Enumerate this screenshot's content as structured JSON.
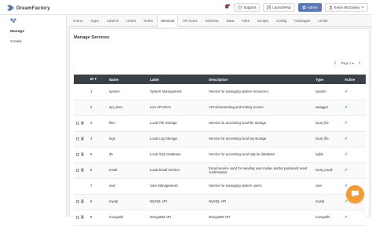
{
  "app": {
    "brand": "DreamFactory"
  },
  "topbar": {
    "support_label": "Support",
    "launchpad_label": "LaunchPad",
    "admin_label": "Admin",
    "user_label": "Kevin McGahey"
  },
  "sidebar": {
    "items": [
      {
        "label": "Manage",
        "active": true
      },
      {
        "label": "Create",
        "active": false
      }
    ]
  },
  "nav": {
    "tabs": [
      {
        "label": "Home",
        "active": false
      },
      {
        "label": "Apps",
        "active": false
      },
      {
        "label": "Admins",
        "active": false
      },
      {
        "label": "Users",
        "active": false
      },
      {
        "label": "Roles",
        "active": false
      },
      {
        "label": "Services",
        "active": true
      },
      {
        "label": "API Docs",
        "active": false
      },
      {
        "label": "Schema",
        "active": false
      },
      {
        "label": "Data",
        "active": false
      },
      {
        "label": "Files",
        "active": false
      },
      {
        "label": "Scripts",
        "active": false
      },
      {
        "label": "Config",
        "active": false
      },
      {
        "label": "Packages",
        "active": false
      },
      {
        "label": "Limits",
        "active": false
      }
    ]
  },
  "panel": {
    "title": "Manage Services",
    "pager": "Page 1"
  },
  "table": {
    "headers": {
      "id": "ID",
      "name": "Name",
      "label": "Label",
      "description": "Description",
      "type": "Type",
      "active": "Active"
    },
    "rows": [
      {
        "selectable": false,
        "id": "1",
        "name": "system",
        "label": "System Management",
        "description": "Service for managing system resources.",
        "type": "system",
        "active": "✓"
      },
      {
        "selectable": false,
        "id": "2",
        "name": "api_docs",
        "label": "Live API Docs",
        "description": "API documenting and testing service.",
        "type": "swagger",
        "active": "✓"
      },
      {
        "selectable": true,
        "id": "3",
        "name": "files",
        "label": "Local File Storage",
        "description": "Service for accessing local file storage.",
        "type": "local_file",
        "active": "✓"
      },
      {
        "selectable": true,
        "id": "4",
        "name": "logs",
        "label": "Local Log Storage",
        "description": "Service for accessing local log storage.",
        "type": "local_file",
        "active": "✓"
      },
      {
        "selectable": true,
        "id": "5",
        "name": "db",
        "label": "Local SQL Database",
        "description": "Service for accessing local SQLite database.",
        "type": "sqlite",
        "active": "✓"
      },
      {
        "selectable": true,
        "id": "6",
        "name": "email",
        "label": "Local Email Service",
        "description": "Email service used for sending user invites and/or password reset confirmation.",
        "type": "local_email",
        "active": "✓"
      },
      {
        "selectable": false,
        "id": "7",
        "name": "user",
        "label": "User Management",
        "description": "Service for managing system users.",
        "type": "user",
        "active": "✓"
      },
      {
        "selectable": true,
        "id": "8",
        "name": "mysql",
        "label": "MySQL API",
        "description": "MySQL API",
        "type": "mysql",
        "active": "✓"
      },
      {
        "selectable": true,
        "id": "9",
        "name": "mongodb",
        "label": "MongoDB API",
        "description": "MongoDB API",
        "type": "mongodb",
        "active": "✓"
      }
    ]
  },
  "colors": {
    "table_header_bg": "#3b4047",
    "admin_button": "#5a79b5",
    "active_check": "#2a8c3c",
    "chat_button": "#f39c34",
    "notification_dot": "#e23a3a"
  },
  "icons": {
    "brand": "dreamfactory-logo-icon",
    "bell": "bell-icon",
    "support": "question-icon",
    "launchpad": "launchpad-icon",
    "admin": "gear-icon",
    "user": "user-icon",
    "sidebar_head": "services-icon",
    "sort": "sort-icon",
    "chat": "chat-icon"
  }
}
